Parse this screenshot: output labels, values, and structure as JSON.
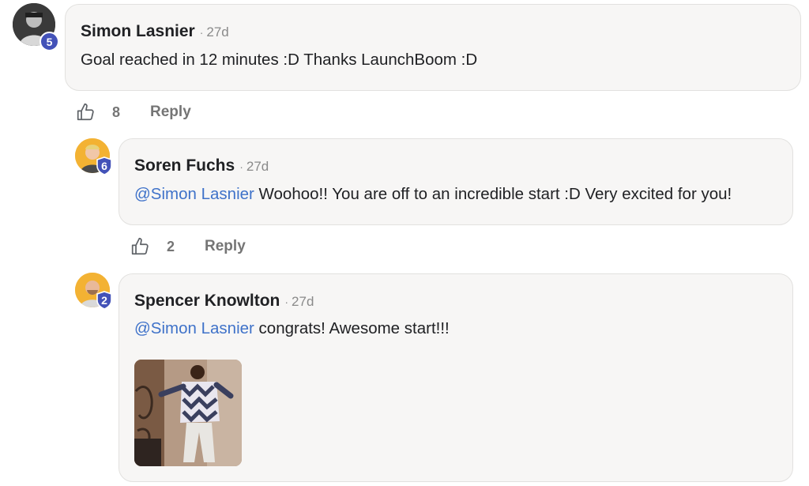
{
  "comments": [
    {
      "author": "Simon Lasnier",
      "time": "27d",
      "badge": "5",
      "text": "Goal reached in 12 minutes :D Thanks LaunchBoom :D",
      "likes": "8",
      "reply_label": "Reply"
    }
  ],
  "replies": [
    {
      "author": "Soren Fuchs",
      "time": "27d",
      "badge": "6",
      "mention": "@Simon Lasnier",
      "text": " Woohoo!! You are off to an incredible start :D Very excited for you!",
      "likes": "2",
      "reply_label": "Reply"
    },
    {
      "author": "Spencer Knowlton",
      "time": "27d",
      "badge": "2",
      "mention": "@Simon Lasnier",
      "text": " congrats! Awesome start!!!"
    }
  ],
  "separator": "·",
  "colors": {
    "mention": "#3f72c9",
    "badge": "#4352b8",
    "bubble": "#f7f6f5",
    "avatar_bg": "#f3b233"
  },
  "icons": {
    "like": "thumbs-up-icon",
    "badge": "level-badge-icon",
    "gif": "gif-image"
  }
}
